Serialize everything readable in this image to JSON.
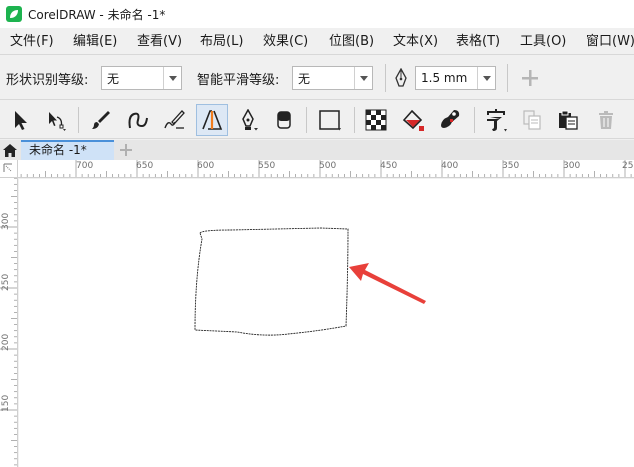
{
  "window": {
    "title": "CorelDRAW - 未命名 -1*"
  },
  "menu": [
    {
      "label": "文件(F)"
    },
    {
      "label": "编辑(E)"
    },
    {
      "label": "查看(V)"
    },
    {
      "label": "布局(L)"
    },
    {
      "label": "效果(C)"
    },
    {
      "label": "位图(B)"
    },
    {
      "label": "文本(X)"
    },
    {
      "label": "表格(T)"
    },
    {
      "label": "工具(O)"
    },
    {
      "label": "窗口(W)"
    }
  ],
  "property_bar": {
    "shape_recognition_label": "形状识别等级:",
    "shape_recognition_value": "无",
    "smoothing_label": "智能平滑等级:",
    "smoothing_value": "无",
    "outline_width_value": "1.5 mm"
  },
  "tabs": [
    {
      "label": "未命名 -1*"
    }
  ],
  "ruler": {
    "horizontal_ticks": [
      "700",
      "650",
      "600",
      "550",
      "500",
      "450",
      "400",
      "350",
      "300",
      "25"
    ],
    "vertical_ticks": [
      "300",
      "250",
      "200",
      "150"
    ]
  },
  "colors": {
    "accent": "#4a90d9",
    "annotation_arrow": "#e8403a",
    "active_tool": "#dde8f5"
  }
}
